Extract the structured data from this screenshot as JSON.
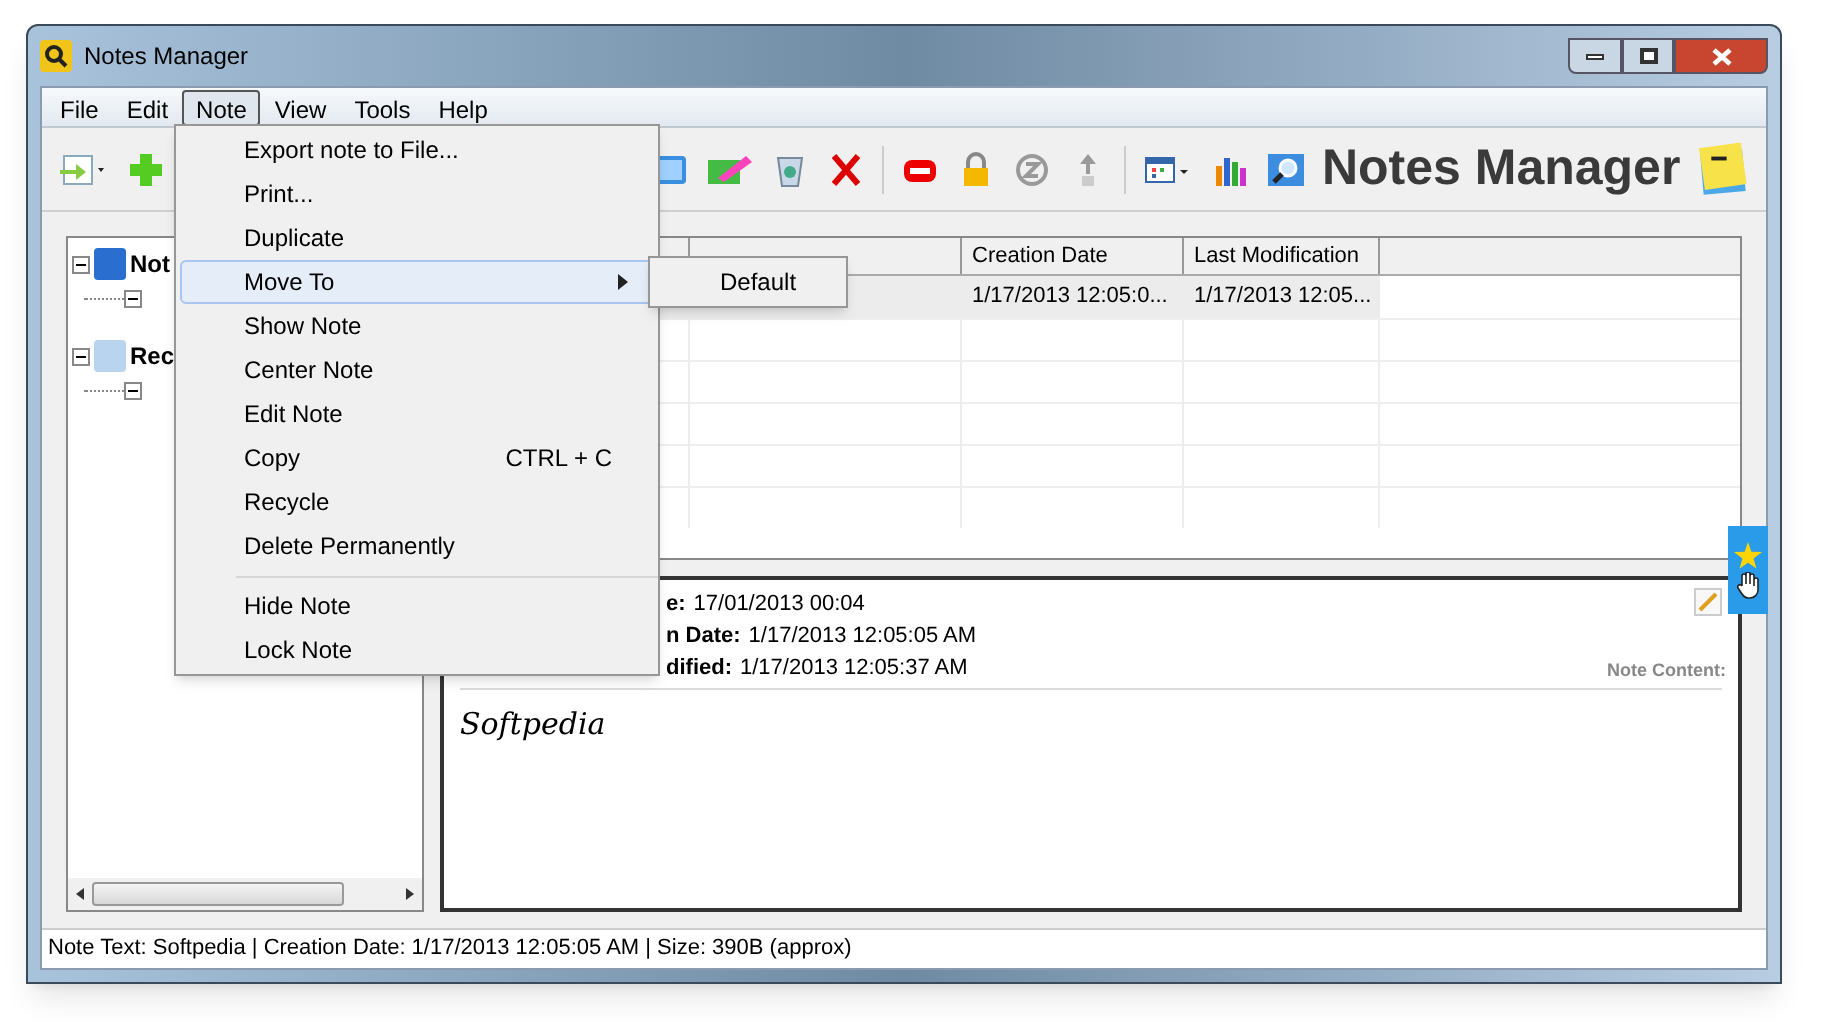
{
  "window": {
    "title": "Notes Manager"
  },
  "menubar": [
    {
      "label": "File",
      "selected": false
    },
    {
      "label": "Edit",
      "selected": false
    },
    {
      "label": "Note",
      "selected": true
    },
    {
      "label": "View",
      "selected": false
    },
    {
      "label": "Tools",
      "selected": false
    },
    {
      "label": "Help",
      "selected": false
    }
  ],
  "note_menu": [
    {
      "kind": "item",
      "label": "Export note to File...",
      "highlighted": false
    },
    {
      "kind": "item",
      "label": "Print...",
      "highlighted": false
    },
    {
      "kind": "item",
      "label": "Duplicate",
      "highlighted": false
    },
    {
      "kind": "submenu",
      "label": "Move To",
      "highlighted": true
    },
    {
      "kind": "item",
      "label": "Show Note",
      "highlighted": false
    },
    {
      "kind": "item",
      "label": "Center Note",
      "highlighted": false
    },
    {
      "kind": "item",
      "label": "Edit Note",
      "highlighted": false
    },
    {
      "kind": "item",
      "label": "Copy",
      "shortcut": "CTRL + C",
      "highlighted": false
    },
    {
      "kind": "item",
      "label": "Recycle",
      "highlighted": false
    },
    {
      "kind": "item",
      "label": "Delete Permanently",
      "highlighted": false
    },
    {
      "kind": "separator"
    },
    {
      "kind": "item",
      "label": "Hide Note",
      "highlighted": false
    },
    {
      "kind": "item",
      "label": "Lock Note",
      "highlighted": false
    }
  ],
  "submenu": [
    {
      "label": "Default"
    }
  ],
  "toolbar": {
    "brand": "Notes Manager"
  },
  "tree": [
    {
      "label": "Not",
      "expanded": true
    },
    {
      "label": "Rec",
      "expanded": true
    }
  ],
  "table": {
    "columns": [
      "Creation Date",
      "Last Modification"
    ],
    "rows": [
      {
        "selected": true,
        "creation_date": "1/17/2013 12:05:0...",
        "last_modification": "1/17/2013 12:05..."
      }
    ]
  },
  "details": {
    "fields": [
      {
        "label": "e:",
        "value": "17/01/2013 00:04"
      },
      {
        "label": "n Date:",
        "value": "1/17/2013 12:05:05 AM"
      },
      {
        "label": "dified:",
        "value": "1/17/2013 12:05:37 AM"
      }
    ],
    "content_label": "Note Content:",
    "content": "Softpedia"
  },
  "status_bar": "Note Text: Softpedia | Creation Date: 1/17/2013 12:05:05 AM | Size: 390B (approx)"
}
